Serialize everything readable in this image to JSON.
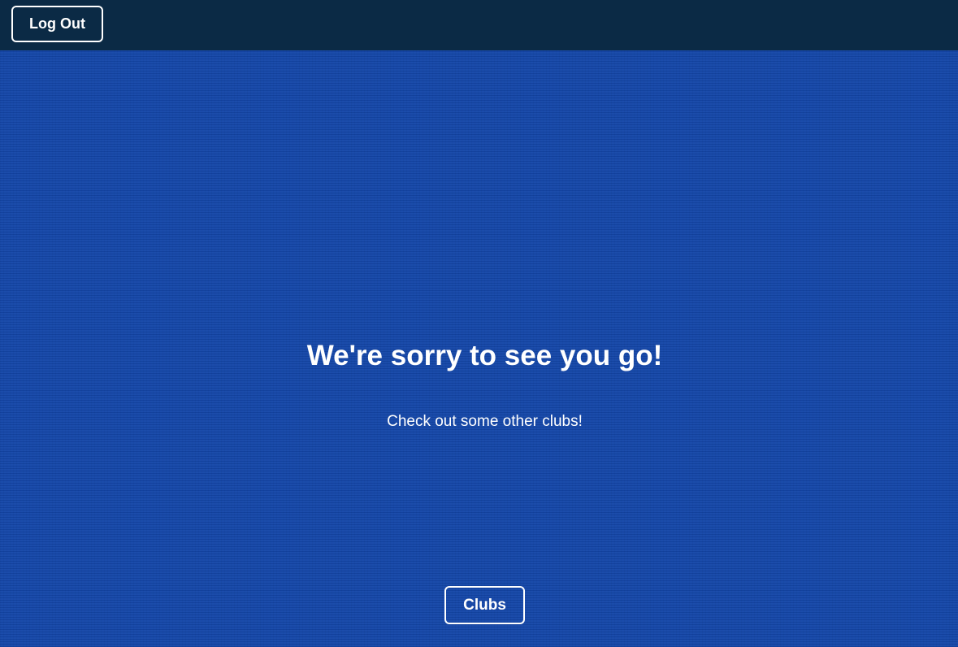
{
  "header": {
    "logout_label": "Log Out"
  },
  "main": {
    "headline": "We're sorry to see you go!",
    "subtext": "Check out some other clubs!",
    "clubs_label": "Clubs"
  },
  "colors": {
    "background": "#1446a8",
    "header_bar": "#0b2a45",
    "text": "#ffffff"
  }
}
